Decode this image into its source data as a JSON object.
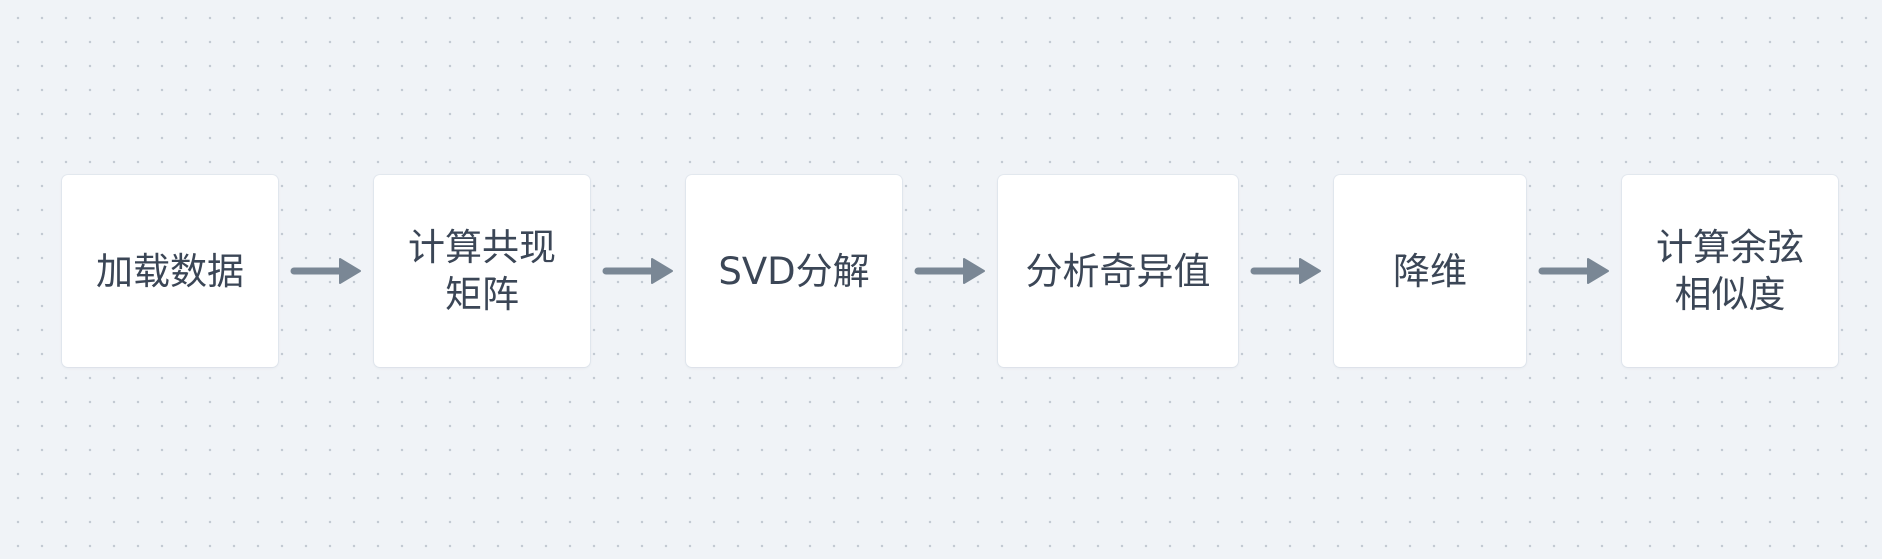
{
  "diagram": {
    "nodes": [
      {
        "id": "load-data",
        "label": "加载数据"
      },
      {
        "id": "compute-cooccurrence",
        "label": "计算共现\n矩阵"
      },
      {
        "id": "svd",
        "label": "SVD分解"
      },
      {
        "id": "singular-values",
        "label": "分析奇异值"
      },
      {
        "id": "reduce-dim",
        "label": "降维"
      },
      {
        "id": "cosine-similarity",
        "label": "计算余弦\n相似度"
      }
    ],
    "edges": [
      {
        "from": "load-data",
        "to": "compute-cooccurrence"
      },
      {
        "from": "compute-cooccurrence",
        "to": "svd"
      },
      {
        "from": "svd",
        "to": "singular-values"
      },
      {
        "from": "singular-values",
        "to": "reduce-dim"
      },
      {
        "from": "reduce-dim",
        "to": "cosine-similarity"
      }
    ],
    "colors": {
      "background": "#f0f3f7",
      "node_fill": "#ffffff",
      "text": "#3b4656",
      "arrow": "#7a8795"
    }
  }
}
